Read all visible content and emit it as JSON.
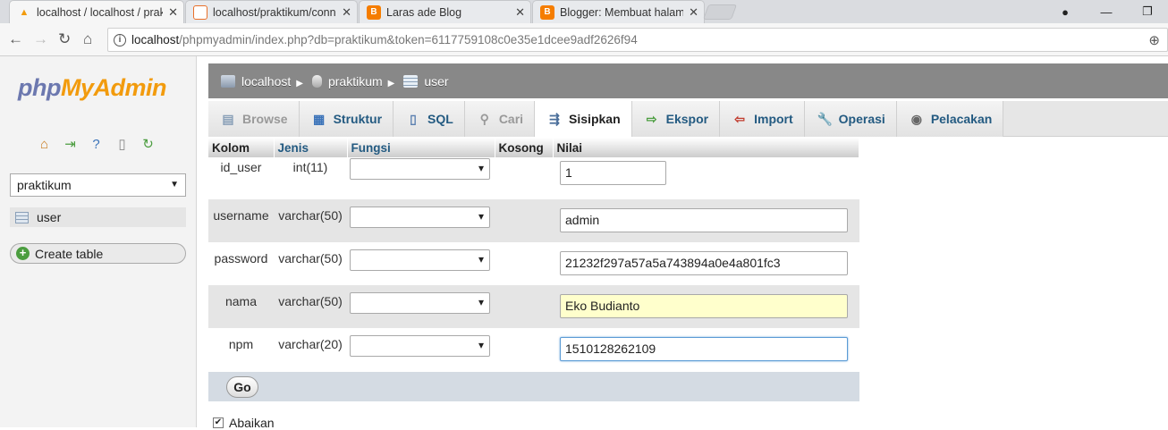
{
  "browser": {
    "tabs": [
      {
        "title": "localhost / localhost / praktikum / user | phpMyAdmin",
        "favicon": "phpmyadmin-icon",
        "active": true
      },
      {
        "title": "localhost/praktikum/connect.php",
        "favicon": "page-icon",
        "active": false
      },
      {
        "title": "Laras ade Blog",
        "favicon": "blogger-icon",
        "active": false
      },
      {
        "title": "Blogger: Membuat halaman",
        "favicon": "blogger-icon",
        "active": false
      }
    ],
    "close_glyph": "✕",
    "url_host": "localhost",
    "url_path": "/phpmyadmin/index.php?db=praktikum&token=6117759108c0e35e1dcee9adf2626f94"
  },
  "sidebar": {
    "logo_php": "php",
    "logo_myadmin": "MyAdmin",
    "db_selected": "praktikum",
    "tree_item": "user",
    "create_table": "Create table"
  },
  "breadcrumb": {
    "server": "localhost",
    "database": "praktikum",
    "table": "user"
  },
  "tabs": [
    {
      "label": "Browse",
      "icon": "browse-icon",
      "state": "disabled"
    },
    {
      "label": "Struktur",
      "icon": "structure-icon",
      "state": "normal"
    },
    {
      "label": "SQL",
      "icon": "sql-icon",
      "state": "normal"
    },
    {
      "label": "Cari",
      "icon": "search-icon",
      "state": "disabled"
    },
    {
      "label": "Sisipkan",
      "icon": "insert-icon",
      "state": "active"
    },
    {
      "label": "Ekspor",
      "icon": "export-icon",
      "state": "normal"
    },
    {
      "label": "Import",
      "icon": "import-icon",
      "state": "normal"
    },
    {
      "label": "Operasi",
      "icon": "wrench-icon",
      "state": "normal"
    },
    {
      "label": "Pelacakan",
      "icon": "eye-icon",
      "state": "normal"
    }
  ],
  "insert_form": {
    "headers": [
      "Kolom",
      "Jenis",
      "Fungsi",
      "Kosong",
      "Nilai"
    ],
    "rows": [
      {
        "column": "id_user",
        "type": "int(11)",
        "function": "",
        "value": "1"
      },
      {
        "column": "username",
        "type": "varchar(50)",
        "function": "",
        "value": "admin"
      },
      {
        "column": "password",
        "type": "varchar(50)",
        "function": "",
        "value": "21232f297a57a5a743894a0e4a801fc3"
      },
      {
        "column": "nama",
        "type": "varchar(50)",
        "function": "",
        "value": "Eko Budianto"
      },
      {
        "column": "npm",
        "type": "varchar(20)",
        "function": "",
        "value": "1510128262109"
      }
    ],
    "go_label": "Go",
    "ignore_label": "Abaikan",
    "ignore_checked": true
  }
}
